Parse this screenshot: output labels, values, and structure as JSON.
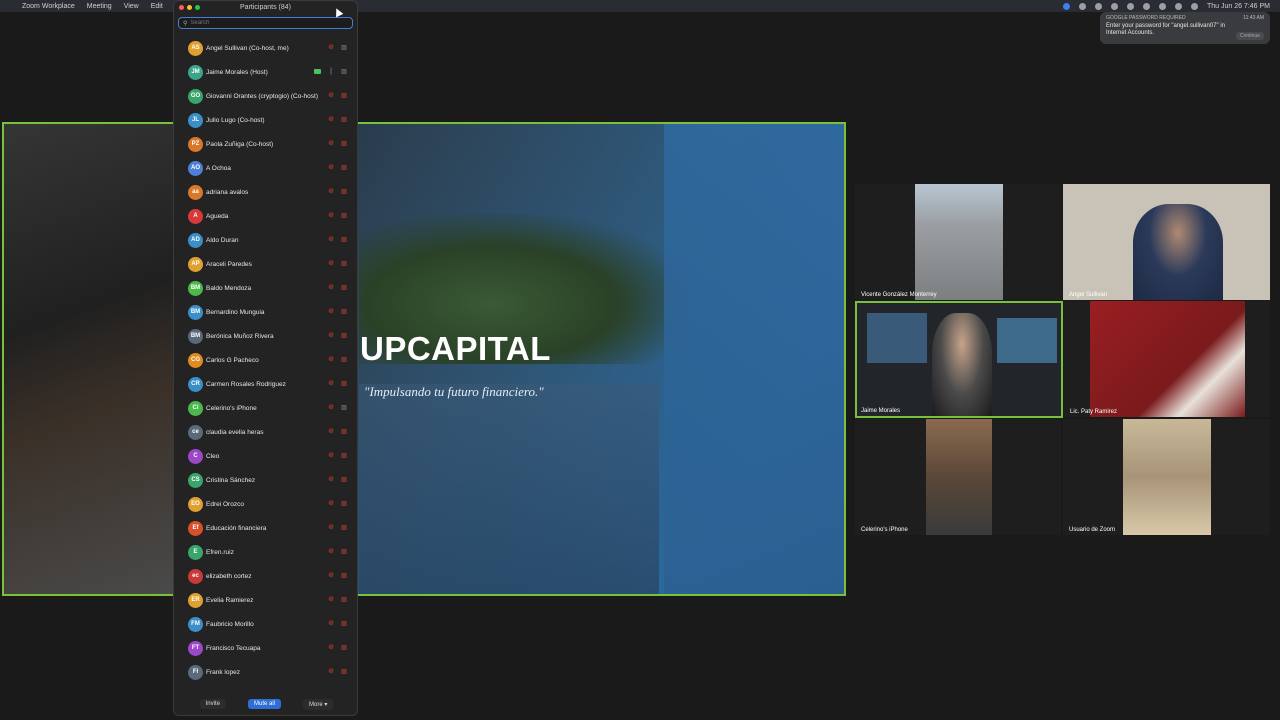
{
  "menubar": {
    "app": "Zoom Workplace",
    "items": [
      "Meeting",
      "View",
      "Edit"
    ],
    "clock": "Thu Jun 26  7:46 PM"
  },
  "notification": {
    "title": "GOOGLE PASSWORD REQUIRED",
    "time": "11:43 AM",
    "body": "Enter your password for \"angel.sullivan07\" in Internet Accounts.",
    "button": "Continue"
  },
  "share": {
    "brand": "UPCAPITAL",
    "tagline": "\"Impulsando tu futuro financiero.\""
  },
  "participants": {
    "title": "Participants (84)",
    "search_placeholder": "Search",
    "items": [
      {
        "initials": "AS",
        "name": "Angel Sullivan (Co-host, me)",
        "color": "#e0a030",
        "mic": "muted",
        "cam": "off-gray"
      },
      {
        "initials": "JM",
        "name": "Jaime Morales (Host)",
        "color": "#3aa58a",
        "mic": "on",
        "cam": "off-gray",
        "badge": true
      },
      {
        "initials": "GO",
        "name": "Giovanni Orantes (cryptogio)  (Co-host)",
        "color": "#3aa56a",
        "mic": "muted",
        "cam": "off"
      },
      {
        "initials": "JL",
        "name": "Julio Lugo (Co-host)",
        "color": "#3a8fc8",
        "mic": "muted",
        "cam": "off"
      },
      {
        "initials": "PZ",
        "name": "Paola Zuñiga (Co-host)",
        "color": "#d8782a",
        "mic": "muted",
        "cam": "off"
      },
      {
        "initials": "AO",
        "name": "A Ochoa",
        "color": "#4f7fd8",
        "mic": "muted",
        "cam": "off"
      },
      {
        "initials": "aa",
        "name": "adriana avalos",
        "color": "#d8782a",
        "mic": "muted",
        "cam": "off"
      },
      {
        "initials": "A",
        "name": "Agueda",
        "color": "#d83a3a",
        "mic": "muted",
        "cam": "off"
      },
      {
        "initials": "AD",
        "name": "Aldo Duran",
        "color": "#3a8fc8",
        "mic": "muted",
        "cam": "off"
      },
      {
        "initials": "AP",
        "name": "Araceli Paredes",
        "color": "#e0a030",
        "mic": "muted",
        "cam": "off"
      },
      {
        "initials": "BM",
        "name": "Baldo Mendoza",
        "color": "#4cb84c",
        "mic": "muted",
        "cam": "off"
      },
      {
        "initials": "BM",
        "name": "Bernardino Munguia",
        "color": "#3a8fc8",
        "mic": "muted",
        "cam": "off"
      },
      {
        "initials": "BM",
        "name": "Berónica Muñoz Rivera",
        "color": "#5a6a7a",
        "mic": "muted",
        "cam": "off"
      },
      {
        "initials": "CG",
        "name": "Carlos G Pacheco",
        "color": "#e08a20",
        "mic": "muted",
        "cam": "off"
      },
      {
        "initials": "CR",
        "name": "Carmen Rosales Rodriguez",
        "color": "#3a8fc8",
        "mic": "muted",
        "cam": "off"
      },
      {
        "initials": "Ci",
        "name": "Celerino's iPhone",
        "color": "#4cb84c",
        "mic": "muted",
        "cam": "off-gray"
      },
      {
        "initials": "ce",
        "name": "claudia evelia heras",
        "color": "#5a6a7a",
        "mic": "muted",
        "cam": "off"
      },
      {
        "initials": "C",
        "name": "Cleo",
        "color": "#9a48c8",
        "mic": "muted",
        "cam": "off"
      },
      {
        "initials": "CS",
        "name": "Cristina Sánchez",
        "color": "#3aa56a",
        "mic": "muted",
        "cam": "off"
      },
      {
        "initials": "EO",
        "name": "Edrei Orozco",
        "color": "#e0a030",
        "mic": "muted",
        "cam": "off"
      },
      {
        "initials": "Ef",
        "name": "Educación financiera",
        "color": "#d8502a",
        "mic": "muted",
        "cam": "off"
      },
      {
        "initials": "E",
        "name": "Efren.ruiz",
        "color": "#3aa56a",
        "mic": "muted",
        "cam": "off"
      },
      {
        "initials": "ec",
        "name": "elizabeth cortez",
        "color": "#c83a3a",
        "mic": "muted",
        "cam": "off"
      },
      {
        "initials": "ER",
        "name": "Evelia Ramierez",
        "color": "#e0a030",
        "mic": "muted",
        "cam": "off"
      },
      {
        "initials": "FM",
        "name": "Faubricio Morillo",
        "color": "#3a8fc8",
        "mic": "muted",
        "cam": "off"
      },
      {
        "initials": "FT",
        "name": "Francisco Tecuapa",
        "color": "#9a48c8",
        "mic": "muted",
        "cam": "off"
      },
      {
        "initials": "Fl",
        "name": "Frank lopez",
        "color": "#5a6a7a",
        "mic": "muted",
        "cam": "off"
      }
    ],
    "footer": {
      "invite": "Invite",
      "mute_all": "Mute all",
      "more": "More ▾"
    }
  },
  "videos": [
    {
      "name": "Vicente González Monterrey",
      "bg": "#8a8f94"
    },
    {
      "name": "Angel Sullivan",
      "bg": "#c9c2b6"
    },
    {
      "name": "Jaime Morales",
      "bg": "#2a2e33"
    },
    {
      "name": "Lic. Paty Ramirez",
      "bg": "#8a1e22"
    },
    {
      "name": "Celerino's iPhone",
      "bg": "#6a5a48"
    },
    {
      "name": "Usuario de Zoom",
      "bg": "#b8a88e"
    }
  ]
}
